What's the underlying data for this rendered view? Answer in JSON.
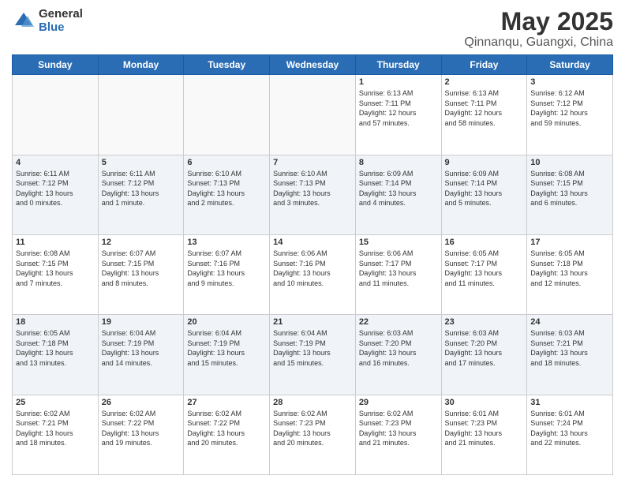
{
  "header": {
    "logo_general": "General",
    "logo_blue": "Blue",
    "title": "May 2025",
    "location": "Qinnanqu, Guangxi, China"
  },
  "weekdays": [
    "Sunday",
    "Monday",
    "Tuesday",
    "Wednesday",
    "Thursday",
    "Friday",
    "Saturday"
  ],
  "weeks": [
    [
      {
        "day": "",
        "info": ""
      },
      {
        "day": "",
        "info": ""
      },
      {
        "day": "",
        "info": ""
      },
      {
        "day": "",
        "info": ""
      },
      {
        "day": "1",
        "info": "Sunrise: 6:13 AM\nSunset: 7:11 PM\nDaylight: 12 hours\nand 57 minutes."
      },
      {
        "day": "2",
        "info": "Sunrise: 6:13 AM\nSunset: 7:11 PM\nDaylight: 12 hours\nand 58 minutes."
      },
      {
        "day": "3",
        "info": "Sunrise: 6:12 AM\nSunset: 7:12 PM\nDaylight: 12 hours\nand 59 minutes."
      }
    ],
    [
      {
        "day": "4",
        "info": "Sunrise: 6:11 AM\nSunset: 7:12 PM\nDaylight: 13 hours\nand 0 minutes."
      },
      {
        "day": "5",
        "info": "Sunrise: 6:11 AM\nSunset: 7:12 PM\nDaylight: 13 hours\nand 1 minute."
      },
      {
        "day": "6",
        "info": "Sunrise: 6:10 AM\nSunset: 7:13 PM\nDaylight: 13 hours\nand 2 minutes."
      },
      {
        "day": "7",
        "info": "Sunrise: 6:10 AM\nSunset: 7:13 PM\nDaylight: 13 hours\nand 3 minutes."
      },
      {
        "day": "8",
        "info": "Sunrise: 6:09 AM\nSunset: 7:14 PM\nDaylight: 13 hours\nand 4 minutes."
      },
      {
        "day": "9",
        "info": "Sunrise: 6:09 AM\nSunset: 7:14 PM\nDaylight: 13 hours\nand 5 minutes."
      },
      {
        "day": "10",
        "info": "Sunrise: 6:08 AM\nSunset: 7:15 PM\nDaylight: 13 hours\nand 6 minutes."
      }
    ],
    [
      {
        "day": "11",
        "info": "Sunrise: 6:08 AM\nSunset: 7:15 PM\nDaylight: 13 hours\nand 7 minutes."
      },
      {
        "day": "12",
        "info": "Sunrise: 6:07 AM\nSunset: 7:15 PM\nDaylight: 13 hours\nand 8 minutes."
      },
      {
        "day": "13",
        "info": "Sunrise: 6:07 AM\nSunset: 7:16 PM\nDaylight: 13 hours\nand 9 minutes."
      },
      {
        "day": "14",
        "info": "Sunrise: 6:06 AM\nSunset: 7:16 PM\nDaylight: 13 hours\nand 10 minutes."
      },
      {
        "day": "15",
        "info": "Sunrise: 6:06 AM\nSunset: 7:17 PM\nDaylight: 13 hours\nand 11 minutes."
      },
      {
        "day": "16",
        "info": "Sunrise: 6:05 AM\nSunset: 7:17 PM\nDaylight: 13 hours\nand 11 minutes."
      },
      {
        "day": "17",
        "info": "Sunrise: 6:05 AM\nSunset: 7:18 PM\nDaylight: 13 hours\nand 12 minutes."
      }
    ],
    [
      {
        "day": "18",
        "info": "Sunrise: 6:05 AM\nSunset: 7:18 PM\nDaylight: 13 hours\nand 13 minutes."
      },
      {
        "day": "19",
        "info": "Sunrise: 6:04 AM\nSunset: 7:19 PM\nDaylight: 13 hours\nand 14 minutes."
      },
      {
        "day": "20",
        "info": "Sunrise: 6:04 AM\nSunset: 7:19 PM\nDaylight: 13 hours\nand 15 minutes."
      },
      {
        "day": "21",
        "info": "Sunrise: 6:04 AM\nSunset: 7:19 PM\nDaylight: 13 hours\nand 15 minutes."
      },
      {
        "day": "22",
        "info": "Sunrise: 6:03 AM\nSunset: 7:20 PM\nDaylight: 13 hours\nand 16 minutes."
      },
      {
        "day": "23",
        "info": "Sunrise: 6:03 AM\nSunset: 7:20 PM\nDaylight: 13 hours\nand 17 minutes."
      },
      {
        "day": "24",
        "info": "Sunrise: 6:03 AM\nSunset: 7:21 PM\nDaylight: 13 hours\nand 18 minutes."
      }
    ],
    [
      {
        "day": "25",
        "info": "Sunrise: 6:02 AM\nSunset: 7:21 PM\nDaylight: 13 hours\nand 18 minutes."
      },
      {
        "day": "26",
        "info": "Sunrise: 6:02 AM\nSunset: 7:22 PM\nDaylight: 13 hours\nand 19 minutes."
      },
      {
        "day": "27",
        "info": "Sunrise: 6:02 AM\nSunset: 7:22 PM\nDaylight: 13 hours\nand 20 minutes."
      },
      {
        "day": "28",
        "info": "Sunrise: 6:02 AM\nSunset: 7:23 PM\nDaylight: 13 hours\nand 20 minutes."
      },
      {
        "day": "29",
        "info": "Sunrise: 6:02 AM\nSunset: 7:23 PM\nDaylight: 13 hours\nand 21 minutes."
      },
      {
        "day": "30",
        "info": "Sunrise: 6:01 AM\nSunset: 7:23 PM\nDaylight: 13 hours\nand 21 minutes."
      },
      {
        "day": "31",
        "info": "Sunrise: 6:01 AM\nSunset: 7:24 PM\nDaylight: 13 hours\nand 22 minutes."
      }
    ]
  ]
}
